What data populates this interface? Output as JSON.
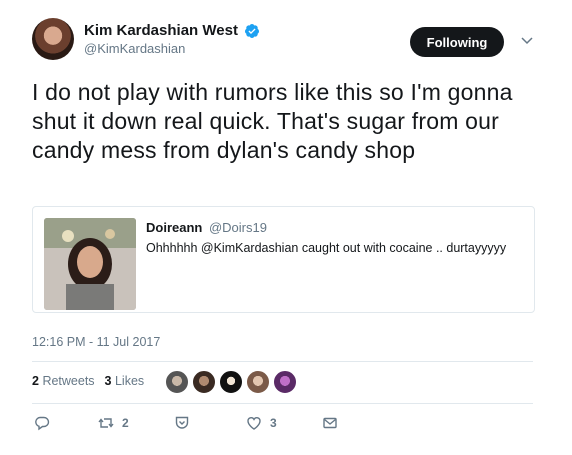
{
  "author": {
    "display_name": "Kim Kardashian West",
    "handle": "@KimKardashian",
    "verified": true,
    "verified_color": "#1da1f2"
  },
  "follow_button": {
    "label": "Following"
  },
  "tweet": {
    "text": "I do not play with rumors like this so I'm gonna shut it down real quick. That's sugar from our candy mess from dylan's candy shop",
    "timestamp": "12:16 PM - 11 Jul 2017"
  },
  "quoted_tweet": {
    "name": "Doireann",
    "handle": "@Doirs19",
    "text": "Ohhhhhh @KimKardashian caught out with cocaine .. durtayyyyy"
  },
  "stats": {
    "retweets_count": "2",
    "retweets_label": "Retweets",
    "likes_count": "3",
    "likes_label": "Likes"
  },
  "actions": {
    "reply_icon": "reply-icon",
    "retweet_icon": "retweet-icon",
    "retweet_count": "2",
    "nofollow_icon": "shield-icon",
    "like_icon": "heart-icon",
    "like_count": "3",
    "dm_icon": "envelope-icon"
  }
}
